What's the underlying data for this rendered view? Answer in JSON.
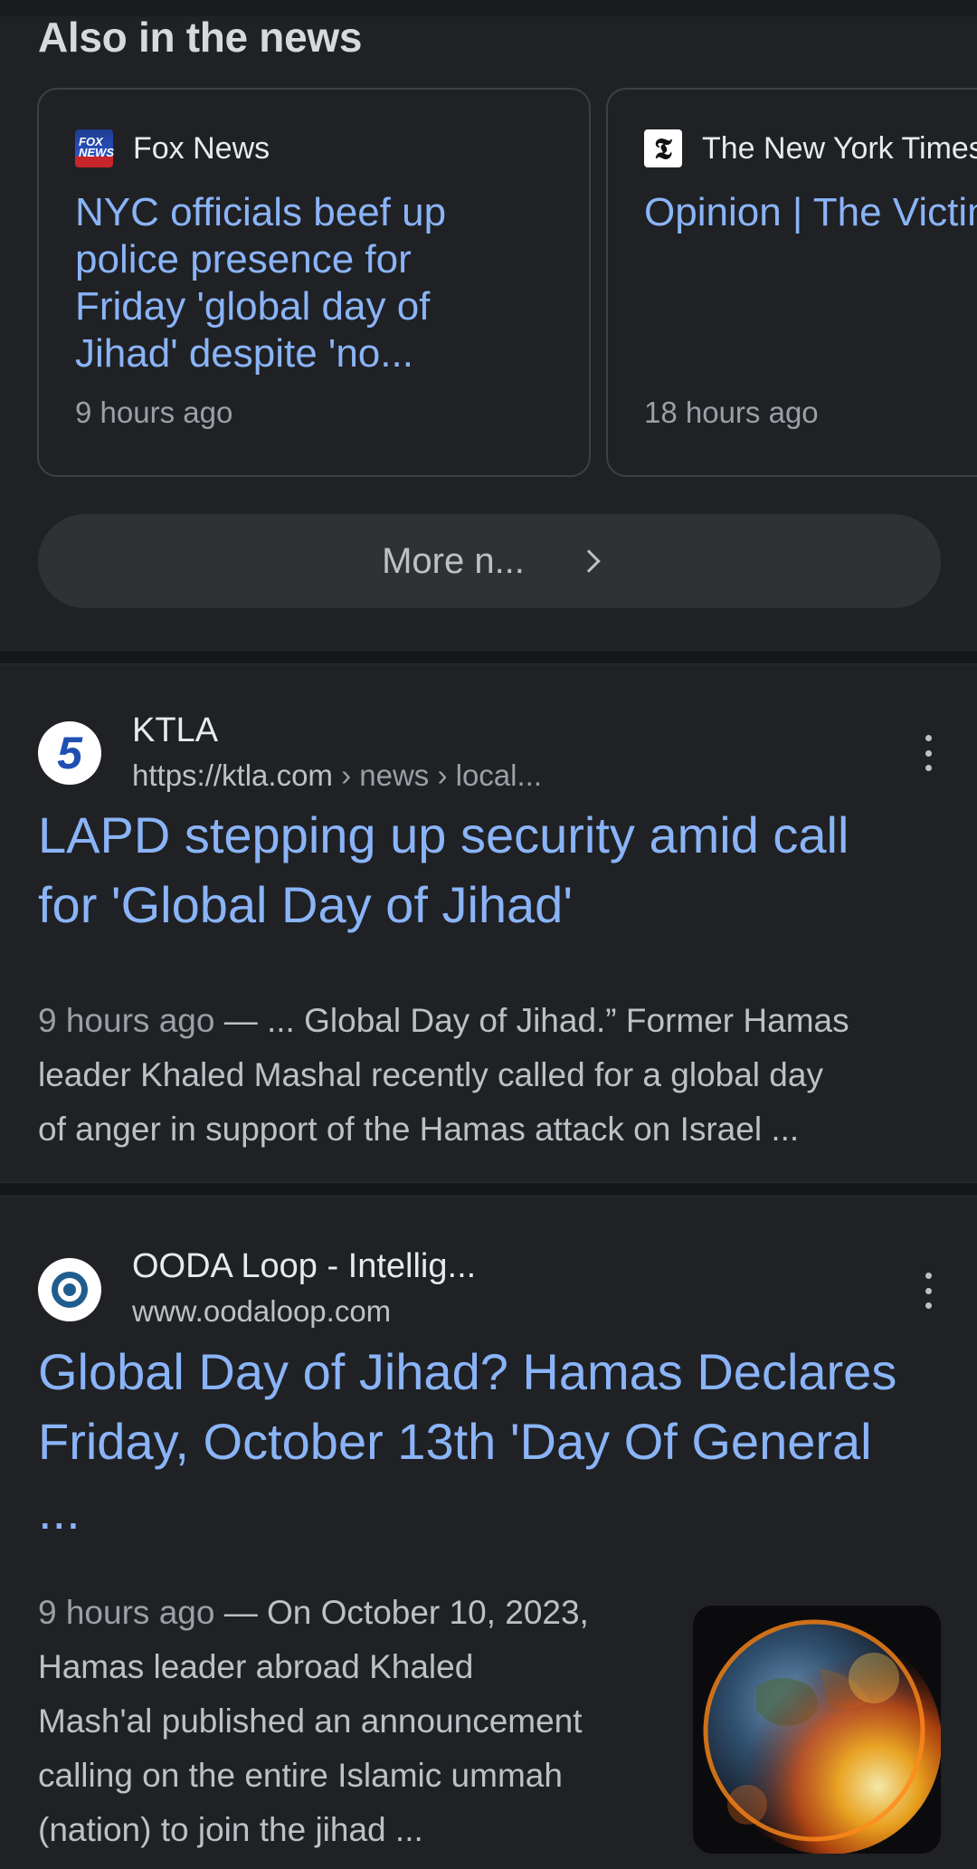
{
  "also_in_news": {
    "title": "Also in the news",
    "cards": [
      {
        "source": "Fox News",
        "logo_icon": "fox-news-logo",
        "headline": "NYC officials beef up\npolice presence for\nFriday 'global day of\nJihad' despite 'no...",
        "time": "9 hours ago"
      },
      {
        "source": "The New York Times",
        "logo_icon": "nyt-logo",
        "headline": "Opinion | The Victims of\nthe Israel-Hamas War",
        "time": "18 hours ago"
      }
    ],
    "more_label": "More n..."
  },
  "results": [
    {
      "site_name": "KTLA",
      "url_domain": "https://ktla.com",
      "url_path": " › news › local...",
      "title": "LAPD stepping up security amid call\nfor 'Global Day of Jihad'",
      "time": "9 hours ago",
      "snippet": " — ... Global Day of Jihad.” Former Hamas\nleader Khaled Mashal recently called for a global day\nof anger in support of the Hamas attack on Israel ..."
    },
    {
      "site_name": "OODA Loop - Intellig...",
      "url_domain": "www.oodaloop.com",
      "title": "Global Day of Jihad? Hamas Declares\nFriday, October 13th 'Day Of General\n...",
      "time": "9 hours ago",
      "snippet": " — On October 10, 2023,\nHamas leader abroad Khaled\nMash'al published an announcement\ncalling on the entire Islamic ummah\n(nation) to join the jihad ...",
      "thumbnail": "burning-earth-image"
    }
  ],
  "colors": {
    "background": "#202124",
    "link": "#8ab4f8",
    "text_primary": "#e8eaed",
    "text_secondary": "#9aa0a6"
  }
}
